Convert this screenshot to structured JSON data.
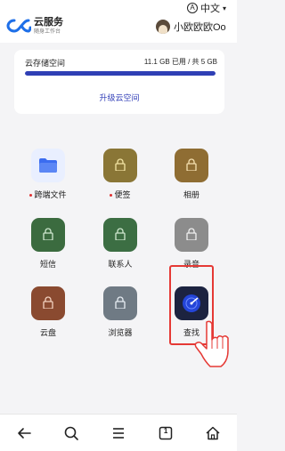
{
  "header": {
    "brand_title": "云服务",
    "brand_subtitle": "随身工作台",
    "language_label": "中文",
    "language_badge": "A",
    "username": "小欧欧欧Oo"
  },
  "storage": {
    "title": "云存储空间",
    "usage_text": "11.1 GB 已用 / 共 5 GB",
    "usage_fraction": 1.0,
    "upgrade_label": "升级云空间",
    "bar_color": "#2f3fb5"
  },
  "apps": [
    {
      "name": "跨端文件",
      "icon": "folder-icon",
      "color": "#e9efff",
      "badge_dot": true
    },
    {
      "name": "便签",
      "icon": "notes-lock-icon",
      "color": "#8a7636",
      "badge_dot": true
    },
    {
      "name": "相册",
      "icon": "gallery-lock-icon",
      "color": "#8f6d33",
      "badge_dot": false
    },
    {
      "name": "短信",
      "icon": "sms-lock-icon",
      "color": "#3b6b3f",
      "badge_dot": false
    },
    {
      "name": "联系人",
      "icon": "contacts-lock-icon",
      "color": "#3c6e43",
      "badge_dot": false
    },
    {
      "name": "录音",
      "icon": "recorder-lock-icon",
      "color": "#8c8c8c",
      "badge_dot": false
    },
    {
      "name": "云盘",
      "icon": "cloud-drive-lock-icon",
      "color": "#8a4a30",
      "badge_dot": false
    },
    {
      "name": "浏览器",
      "icon": "browser-lock-icon",
      "color": "#6f7a84",
      "badge_dot": false
    },
    {
      "name": "查找",
      "icon": "find-device-icon",
      "color": "#1c2340",
      "badge_dot": false
    }
  ],
  "navbar": {
    "items": [
      "back-icon",
      "search-icon",
      "menu-icon",
      "tabs-icon",
      "home-icon"
    ],
    "tabs_count": "1"
  }
}
